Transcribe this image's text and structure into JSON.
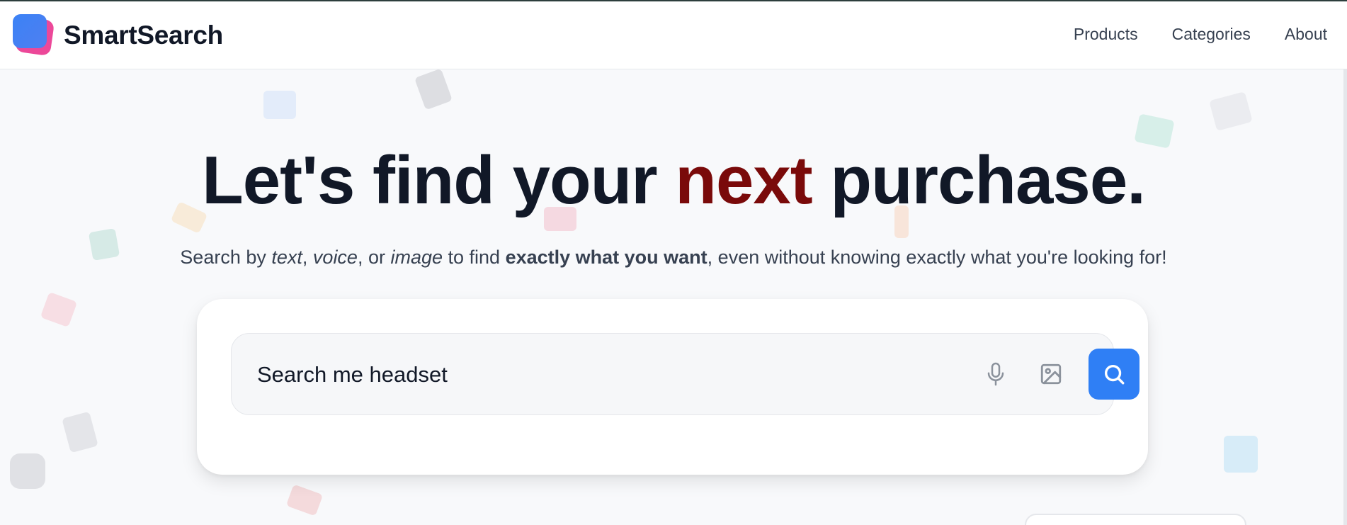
{
  "header": {
    "brand": "SmartSearch",
    "nav": [
      "Products",
      "Categories",
      "About"
    ]
  },
  "hero": {
    "title_before": "Let's find your ",
    "title_accent": "next",
    "title_after": " purchase.",
    "subtitle": {
      "p1": "Search by ",
      "em1": "text",
      "p2": ", ",
      "em2": "voice",
      "p3": ", or ",
      "em3": "image",
      "p4": " to find ",
      "strong": "exactly what you want",
      "p5": ", even without knowing exactly what you're looking for!"
    }
  },
  "search": {
    "value": "Search me headset"
  },
  "icons": {
    "mic": "microphone-icon",
    "image": "image-icon",
    "search": "search-icon"
  },
  "colors": {
    "accent": "#7a0a0a",
    "primary": "#2f7ff5",
    "logo_front": "#3b82f6",
    "logo_back": "#ec4899"
  }
}
